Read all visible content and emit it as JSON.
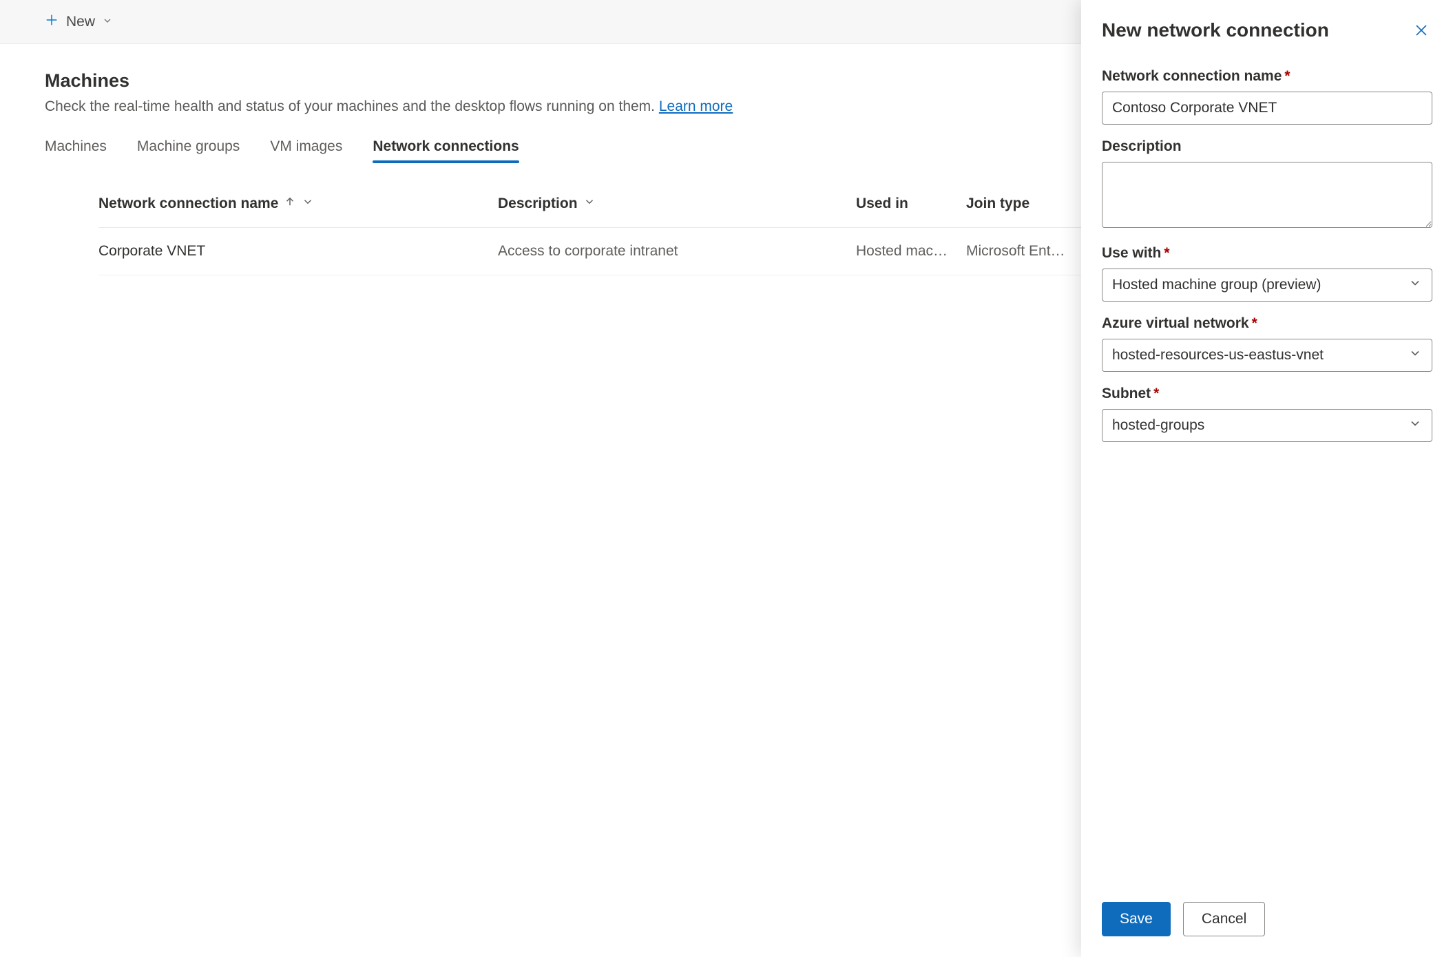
{
  "cmdbar": {
    "new_label": "New"
  },
  "header": {
    "title": "Machines",
    "desc_prefix": "Check the real-time health and status of your machines and the desktop flows running on them. ",
    "learn_more": "Learn more"
  },
  "tabs": {
    "machines": "Machines",
    "machine_groups": "Machine groups",
    "vm_images": "VM images",
    "network_connections": "Network connections"
  },
  "table": {
    "columns": {
      "name": "Network connection name",
      "description": "Description",
      "used_in": "Used in",
      "join_type": "Join type"
    },
    "rows": [
      {
        "name": "Corporate VNET",
        "description": "Access to corporate intranet",
        "used_in": "Hosted mach…",
        "join_type": "Microsoft Ent…"
      }
    ]
  },
  "panel": {
    "title": "New network connection",
    "fields": {
      "name_label": "Network connection name",
      "name_value": "Contoso Corporate VNET",
      "description_label": "Description",
      "description_value": "",
      "use_with_label": "Use with",
      "use_with_value": "Hosted machine group (preview)",
      "avnet_label": "Azure virtual network",
      "avnet_value": "hosted-resources-us-eastus-vnet",
      "subnet_label": "Subnet",
      "subnet_value": "hosted-groups"
    },
    "buttons": {
      "save": "Save",
      "cancel": "Cancel"
    }
  }
}
